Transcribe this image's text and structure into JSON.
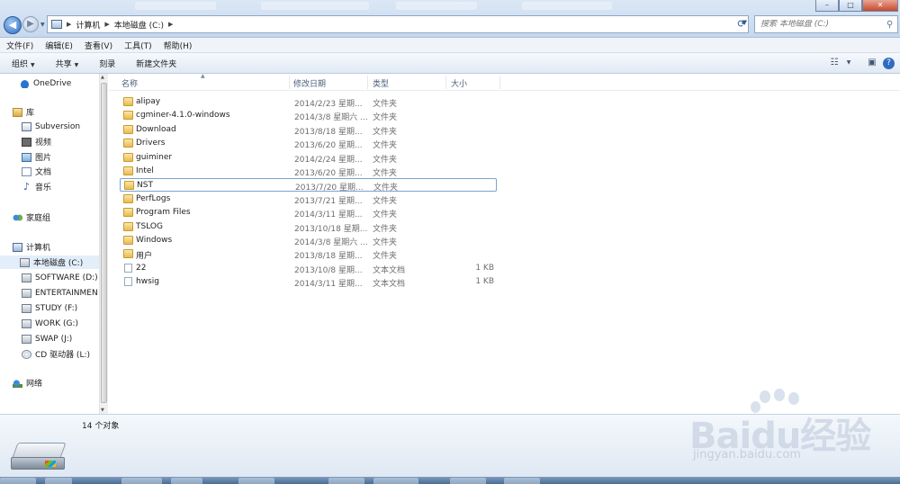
{
  "address": {
    "segments": [
      "计算机",
      "本地磁盘 (C:)"
    ]
  },
  "search": {
    "placeholder": "搜索 本地磁盘 (C:)"
  },
  "menu": [
    "文件(F)",
    "编辑(E)",
    "查看(V)",
    "工具(T)",
    "帮助(H)"
  ],
  "commands": [
    {
      "label": "组织",
      "dropdown": true
    },
    {
      "label": "共享",
      "dropdown": true
    },
    {
      "label": "刻录",
      "dropdown": false
    },
    {
      "label": "新建文件夹",
      "dropdown": false
    }
  ],
  "nav": [
    {
      "label": "OneDrive",
      "icon": "onedrive-icon",
      "selected": false
    },
    {
      "label": "库",
      "icon": "library-icon",
      "selected": false
    },
    {
      "label": "Subversion",
      "icon": "subversion-icon",
      "selected": false
    },
    {
      "label": "视频",
      "icon": "video-icon",
      "selected": false
    },
    {
      "label": "图片",
      "icon": "picture-icon",
      "selected": false
    },
    {
      "label": "文档",
      "icon": "document-icon",
      "selected": false
    },
    {
      "label": "音乐",
      "icon": "music-icon",
      "selected": false
    },
    {
      "label": "家庭组",
      "icon": "homegroup-icon",
      "selected": false
    },
    {
      "label": "计算机",
      "icon": "computer-icon",
      "selected": false
    },
    {
      "label": "本地磁盘 (C:)",
      "icon": "drive-icon",
      "selected": true
    },
    {
      "label": "SOFTWARE (D:)",
      "icon": "drive-icon",
      "selected": false
    },
    {
      "label": "ENTERTAINMEN",
      "icon": "drive-icon",
      "selected": false
    },
    {
      "label": "STUDY (F:)",
      "icon": "drive-icon",
      "selected": false
    },
    {
      "label": "WORK (G:)",
      "icon": "drive-icon",
      "selected": false
    },
    {
      "label": "SWAP (J:)",
      "icon": "drive-icon",
      "selected": false
    },
    {
      "label": "CD 驱动器 (L:)",
      "icon": "cd-icon",
      "selected": false
    },
    {
      "label": "网络",
      "icon": "network-icon",
      "selected": false
    }
  ],
  "columns": {
    "name": "名称",
    "date": "修改日期",
    "type": "类型",
    "size": "大小"
  },
  "files": [
    {
      "name": "alipay",
      "date": "2014/2/23 星期...",
      "type": "文件夹",
      "size": "",
      "kind": "folder"
    },
    {
      "name": "cgminer-4.1.0-windows",
      "date": "2014/3/8 星期六 ...",
      "type": "文件夹",
      "size": "",
      "kind": "folder"
    },
    {
      "name": "Download",
      "date": "2013/8/18 星期...",
      "type": "文件夹",
      "size": "",
      "kind": "folder"
    },
    {
      "name": "Drivers",
      "date": "2013/6/20 星期...",
      "type": "文件夹",
      "size": "",
      "kind": "folder"
    },
    {
      "name": "guiminer",
      "date": "2014/2/24 星期...",
      "type": "文件夹",
      "size": "",
      "kind": "folder"
    },
    {
      "name": "Intel",
      "date": "2013/6/20 星期...",
      "type": "文件夹",
      "size": "",
      "kind": "folder"
    },
    {
      "name": "NST",
      "date": "2013/7/20 星期...",
      "type": "文件夹",
      "size": "",
      "kind": "folder"
    },
    {
      "name": "PerfLogs",
      "date": "2013/7/21 星期...",
      "type": "文件夹",
      "size": "",
      "kind": "folder"
    },
    {
      "name": "Program Files",
      "date": "2014/3/11 星期...",
      "type": "文件夹",
      "size": "",
      "kind": "folder"
    },
    {
      "name": "TSLOG",
      "date": "2013/10/18 星期...",
      "type": "文件夹",
      "size": "",
      "kind": "folder"
    },
    {
      "name": "Windows",
      "date": "2014/3/8 星期六 ...",
      "type": "文件夹",
      "size": "",
      "kind": "folder"
    },
    {
      "name": "用户",
      "date": "2013/8/18 星期...",
      "type": "文件夹",
      "size": "",
      "kind": "folder"
    },
    {
      "name": "22",
      "date": "2013/10/8 星期...",
      "type": "文本文档",
      "size": "1 KB",
      "kind": "text"
    },
    {
      "name": "hwsig",
      "date": "2014/3/11 星期...",
      "type": "文本文档",
      "size": "1 KB",
      "kind": "text"
    }
  ],
  "hover_index": 6,
  "status": {
    "count": "14 个对象"
  },
  "watermark": {
    "brand": "Baidu经验",
    "url": "jingyan.baidu.com"
  }
}
